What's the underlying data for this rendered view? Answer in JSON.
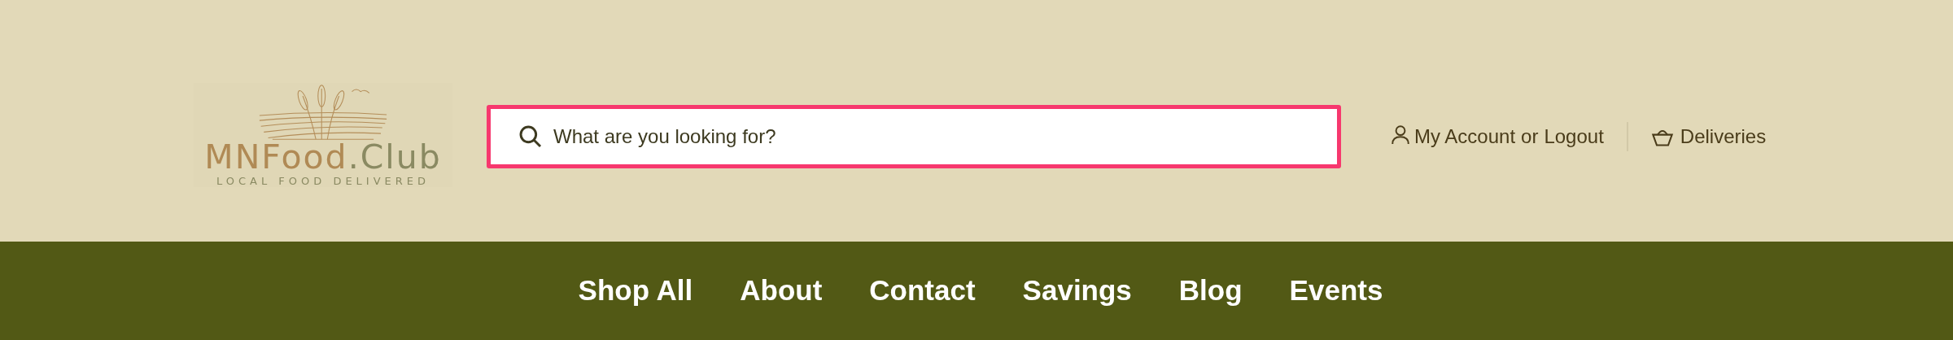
{
  "logo": {
    "name_parts": [
      "MNFood",
      ".Club"
    ],
    "tagline": "LOCAL FOOD DELIVERED"
  },
  "search": {
    "placeholder": "What are you looking for?",
    "focused": true
  },
  "account": {
    "account_link": "My Account",
    "separator_text": "or",
    "logout_link": "Logout"
  },
  "deliveries": {
    "label": "Deliveries"
  },
  "nav": [
    {
      "label": "Shop All"
    },
    {
      "label": "About"
    },
    {
      "label": "Contact"
    },
    {
      "label": "Savings"
    },
    {
      "label": "Blog"
    },
    {
      "label": "Events"
    }
  ]
}
